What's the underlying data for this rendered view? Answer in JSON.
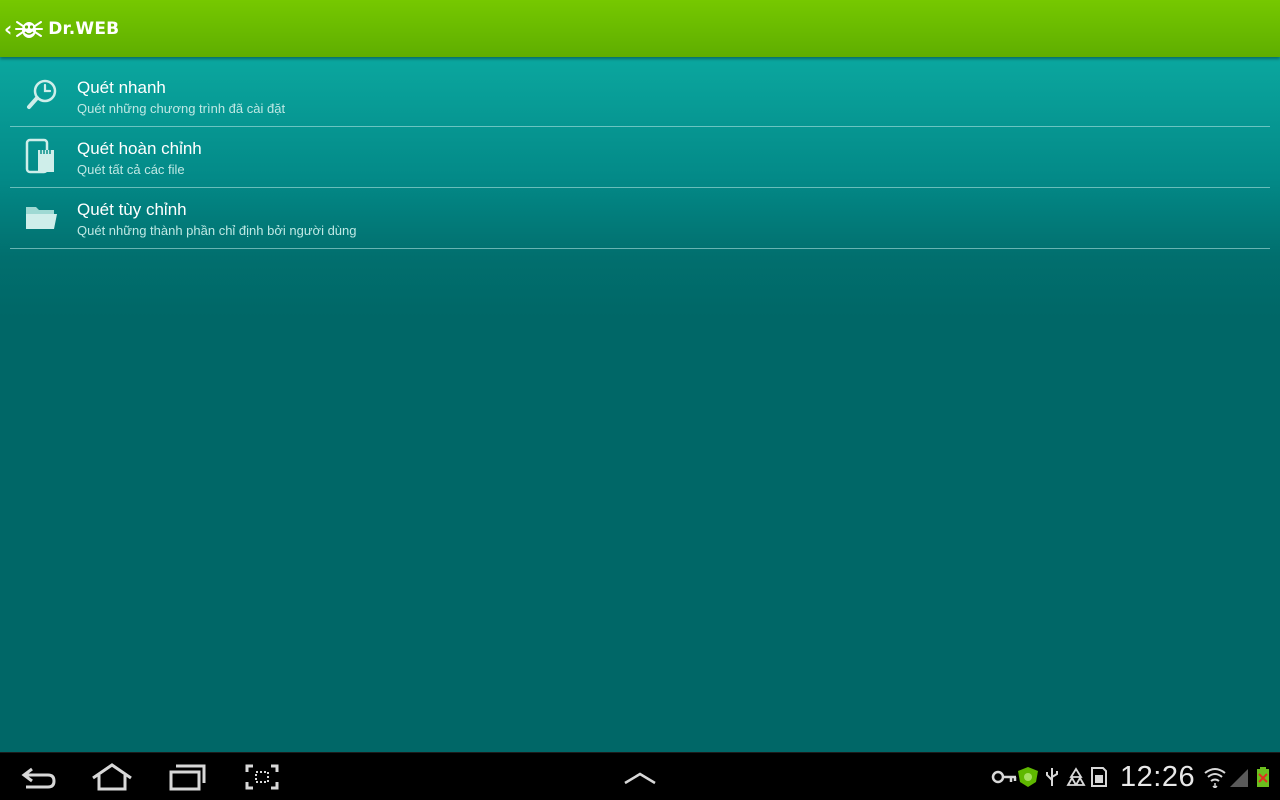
{
  "action_bar": {
    "title": "Dr.WEB",
    "brand_color": "#6cbf00"
  },
  "menu": {
    "items": [
      {
        "title": "Quét nhanh",
        "subtitle": "Quét những chương trình đã cài đặt",
        "icon": "clock-search-icon"
      },
      {
        "title": "Quét hoàn chỉnh",
        "subtitle": "Quét tất cả các file",
        "icon": "device-sdcard-icon"
      },
      {
        "title": "Quét tùy chỉnh",
        "subtitle": "Quét những thành phần chỉ định bởi người dùng",
        "icon": "folder-icon"
      }
    ]
  },
  "system_bar": {
    "nav_buttons": [
      "back-icon",
      "home-icon",
      "recent-apps-icon",
      "screenshot-icon",
      "chevron-up-icon"
    ],
    "status_icons": [
      "key-icon",
      "drweb-shield-icon",
      "usb-icon",
      "recycle-icon",
      "sdcard-icon",
      "wifi-icon",
      "signal-icon",
      "battery-icon"
    ],
    "clock": "12:26"
  },
  "colors": {
    "background": "#006767",
    "list_top": "#0ba79f",
    "subtitle": "#bfe8e4"
  }
}
